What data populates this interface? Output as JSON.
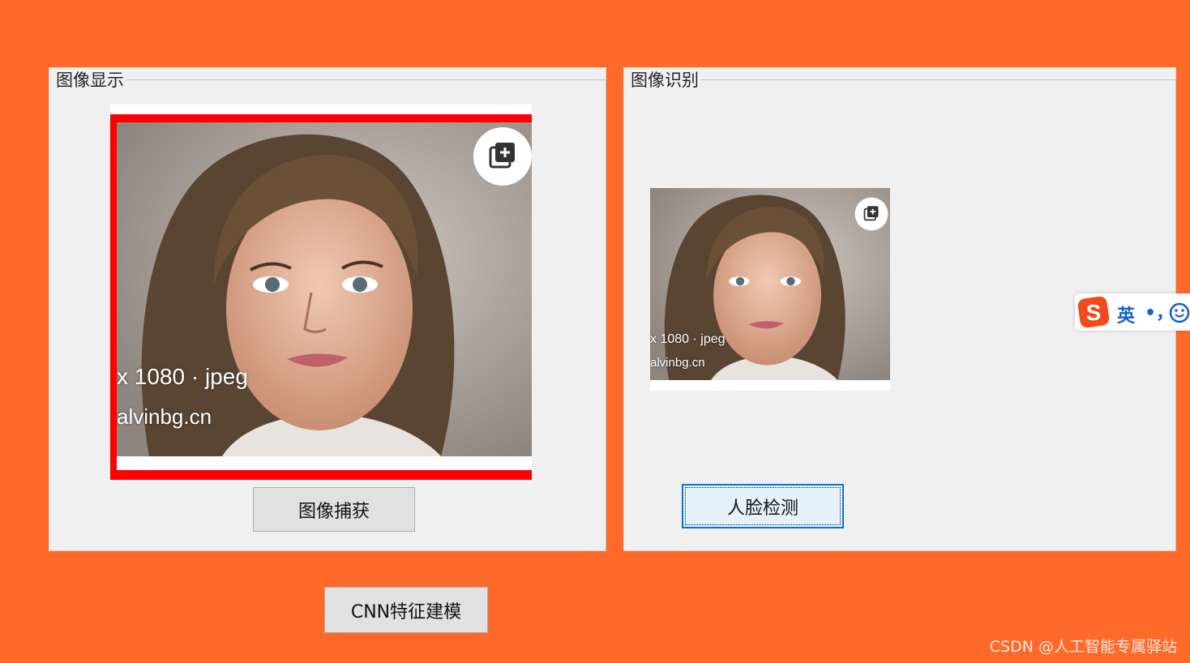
{
  "colors": {
    "background": "#ff6a2b",
    "panel": "#f0f0f0",
    "accent": "#0078d7",
    "selection_border": "#ff0000"
  },
  "display_group": {
    "title": "图像显示",
    "capture_button": "图像捕获",
    "photo_resolution": "x 1080 · jpeg",
    "photo_source": "alvinbg.cn"
  },
  "recognition_group": {
    "title": "图像识别",
    "detect_button": "人脸检测",
    "photo_resolution": "x 1080 · jpeg",
    "photo_source": "alvinbg.cn"
  },
  "cnn_button": "CNN特征建模",
  "ime": {
    "mode": "英",
    "punct": "•，",
    "logo_icon": "sogou-s-icon",
    "emoji_icon": "smile-icon"
  },
  "watermark": "CSDN @人工智能专属驿站"
}
